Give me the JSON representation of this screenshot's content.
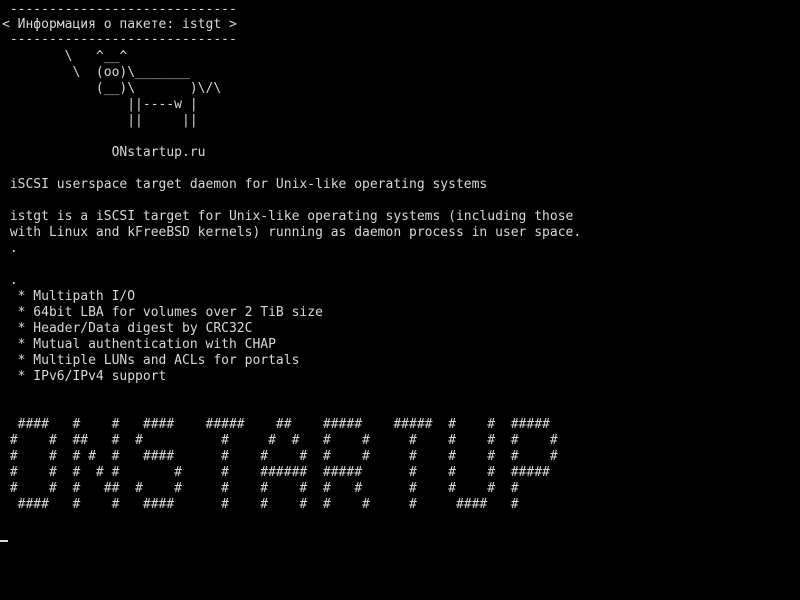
{
  "terminal": {
    "header_rule_top": " -----------------------------",
    "header_title": "< Информация о пакете: istgt >",
    "header_rule_bottom": " -----------------------------",
    "cow": [
      "        \\   ^__^",
      "         \\  (oo)\\_______",
      "            (__)\\       )\\/\\",
      "                ||----w |",
      "                ||     ||"
    ],
    "site": "              ONstartup.ru",
    "summary": " iSCSI userspace target daemon for Unix-like operating systems",
    "description": [
      " istgt is a iSCSI target for Unix-like operating systems (including those",
      " with Linux and kFreeBSD kernels) running as daemon process in user space.",
      " ."
    ],
    "features_sep": " .",
    "features": [
      "  * Multipath I/O",
      "  * 64bit LBA for volumes over 2 TiB size",
      "  * Header/Data digest by CRC32C",
      "  * Mutual authentication with CHAP",
      "  * Multiple LUNs and ACLs for portals",
      "  * IPv6/IPv4 support"
    ],
    "banner": [
      "  ####   #    #   ####    #####    ##    #####    #####  #    #  #####",
      " #    #  ##   #  #          #     #  #   #    #     #    #    #  #    #",
      " #    #  # #  #   ####      #    #    #  #    #     #    #    #  #    #",
      " #    #  #  # #       #     #    ######  #####      #    #    #  #####",
      " #    #  #   ##  #    #     #    #    #  #   #      #    #    #  #",
      "  ####   #    #   ####      #    #    #  #    #     #     ####   #"
    ]
  }
}
